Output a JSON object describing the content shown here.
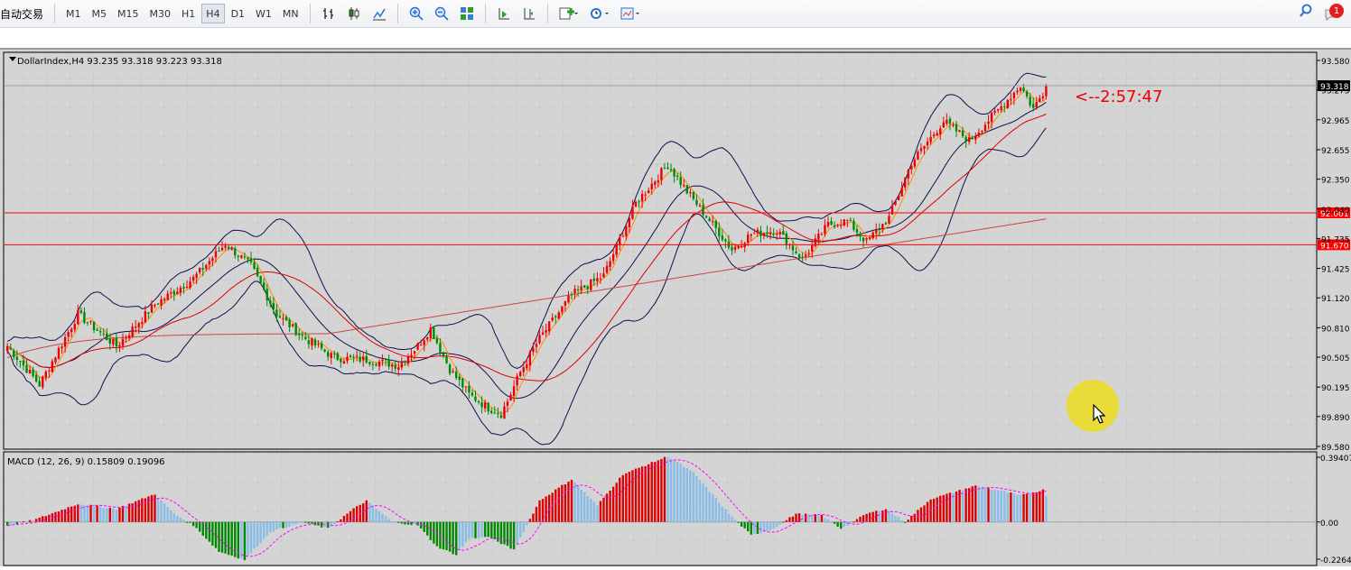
{
  "toolbar": {
    "autotrade_label": "自动交易",
    "timeframes": [
      "M1",
      "M5",
      "M15",
      "M30",
      "H1",
      "H4",
      "D1",
      "W1",
      "MN"
    ],
    "active_timeframe": "H4",
    "notification_count": "1",
    "icons": [
      "bar-chart-icon",
      "candlestick-icon",
      "line-chart-icon",
      "zoom-in-icon",
      "zoom-out-icon",
      "tile-windows-icon",
      "chart-shift-icon",
      "autoscroll-icon",
      "indicators-icon",
      "periods-clock-icon",
      "templates-icon",
      "search-icon",
      "notification-icon"
    ]
  },
  "chart": {
    "header": "DollarIndex,H4  93.235 93.318 93.223 93.318",
    "current_price": "93.318",
    "countdown": "<--2:57:47",
    "hlines": [
      {
        "price": "92.001",
        "value": 92.001
      },
      {
        "price": "91.670",
        "value": 91.67
      }
    ],
    "price_ticks": [
      "93.580",
      "93.275",
      "92.965",
      "92.655",
      "92.350",
      "92.040",
      "91.735",
      "91.425",
      "91.120",
      "90.810",
      "90.505",
      "90.195",
      "89.890",
      "89.580"
    ],
    "ylim": [
      89.58,
      93.58
    ],
    "colors": {
      "bull": "#ee0000",
      "bear": "#008a00",
      "bands": "#101050",
      "ma_fast": "#ff8c00",
      "ma_mid": "#dd0000",
      "ma_slow": "#c84646",
      "hline": "#ff0000"
    }
  },
  "macd": {
    "header": "MACD (12, 26, 9)  0.15809 0.19096",
    "ticks": [
      "0.39407",
      "0.00",
      "-0.22648"
    ],
    "ylim": [
      -0.22648,
      0.39407
    ],
    "colors": {
      "pos": "#dd0000",
      "neg": "#008a00",
      "fade": "#87bde8",
      "signal": "#ff00ff"
    }
  },
  "chart_data": {
    "type": "candlestick",
    "title": "DollarIndex,H4",
    "ylim": [
      89.58,
      93.58
    ],
    "anchors": [
      [
        0,
        90.62
      ],
      [
        10,
        90.22
      ],
      [
        22,
        90.95
      ],
      [
        34,
        90.62
      ],
      [
        46,
        91.05
      ],
      [
        58,
        91.32
      ],
      [
        68,
        91.68
      ],
      [
        76,
        91.45
      ],
      [
        84,
        90.95
      ],
      [
        92,
        90.72
      ],
      [
        102,
        90.5
      ],
      [
        112,
        90.48
      ],
      [
        122,
        90.42
      ],
      [
        128,
        90.62
      ],
      [
        132,
        90.8
      ],
      [
        138,
        90.38
      ],
      [
        144,
        90.12
      ],
      [
        150,
        89.98
      ],
      [
        154,
        89.92
      ],
      [
        156,
        90.05
      ],
      [
        160,
        90.35
      ],
      [
        166,
        90.7
      ],
      [
        176,
        91.15
      ],
      [
        186,
        91.35
      ],
      [
        196,
        92.1
      ],
      [
        206,
        92.5
      ],
      [
        212,
        92.22
      ],
      [
        220,
        91.88
      ],
      [
        226,
        91.62
      ],
      [
        232,
        91.78
      ],
      [
        240,
        91.82
      ],
      [
        248,
        91.52
      ],
      [
        256,
        91.88
      ],
      [
        262,
        91.92
      ],
      [
        268,
        91.7
      ],
      [
        275,
        91.95
      ],
      [
        282,
        92.52
      ],
      [
        292,
        92.95
      ],
      [
        300,
        92.75
      ],
      [
        310,
        93.1
      ],
      [
        316,
        93.32
      ],
      [
        320,
        93.08
      ],
      [
        324,
        93.3
      ]
    ],
    "macd_anchors": [
      [
        0,
        -0.02
      ],
      [
        8,
        0.01
      ],
      [
        22,
        0.11
      ],
      [
        34,
        0.08
      ],
      [
        46,
        0.17
      ],
      [
        52,
        0.05
      ],
      [
        58,
        -0.02
      ],
      [
        66,
        -0.18
      ],
      [
        74,
        -0.23
      ],
      [
        82,
        -0.06
      ],
      [
        92,
        0.0
      ],
      [
        100,
        -0.04
      ],
      [
        108,
        0.08
      ],
      [
        112,
        0.13
      ],
      [
        120,
        0.0
      ],
      [
        128,
        -0.02
      ],
      [
        134,
        -0.15
      ],
      [
        140,
        -0.2
      ],
      [
        144,
        -0.1
      ],
      [
        150,
        -0.09
      ],
      [
        158,
        -0.17
      ],
      [
        166,
        0.13
      ],
      [
        176,
        0.26
      ],
      [
        184,
        0.1
      ],
      [
        192,
        0.29
      ],
      [
        206,
        0.4
      ],
      [
        214,
        0.3
      ],
      [
        226,
        0.03
      ],
      [
        232,
        -0.08
      ],
      [
        238,
        -0.05
      ],
      [
        246,
        0.05
      ],
      [
        254,
        0.04
      ],
      [
        260,
        -0.04
      ],
      [
        268,
        0.05
      ],
      [
        274,
        0.08
      ],
      [
        280,
        0.0
      ],
      [
        288,
        0.14
      ],
      [
        302,
        0.22
      ],
      [
        310,
        0.19
      ],
      [
        316,
        0.16
      ],
      [
        324,
        0.2
      ]
    ],
    "signal_last": 0.19096,
    "macd_last": 0.15809
  }
}
